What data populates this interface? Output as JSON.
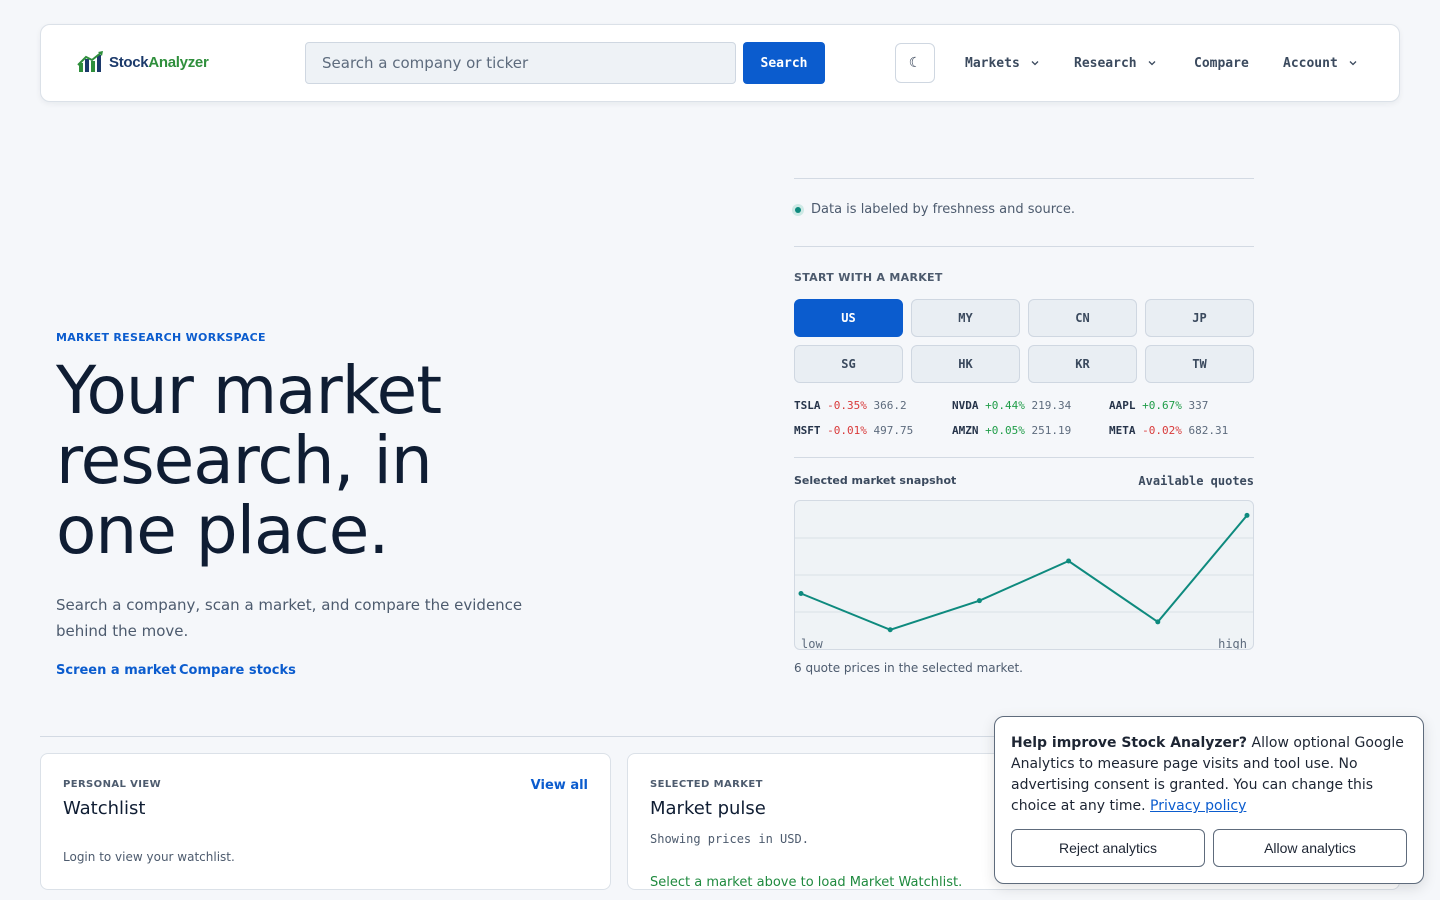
{
  "header": {
    "logo": {
      "part1": "Stock",
      "part2": "Analyzer"
    },
    "search": {
      "placeholder": "Search a company or ticker",
      "button_label": "Search"
    },
    "theme_toggle": "☾",
    "nav": [
      {
        "label": "Markets",
        "has_dropdown": true
      },
      {
        "label": "Research",
        "has_dropdown": true
      },
      {
        "label": "Compare",
        "has_dropdown": false
      },
      {
        "label": "Account",
        "has_dropdown": true
      }
    ]
  },
  "hero": {
    "eyebrow": "MARKET RESEARCH WORKSPACE",
    "headline": [
      "Your market",
      "research, in",
      "one place."
    ],
    "subtitle": "Search a company, scan a market, and compare the evidence behind the move.",
    "links": [
      "Screen a market",
      "Compare stocks"
    ]
  },
  "panel": {
    "freshness": "Data is labeled by freshness and source.",
    "market_label": "START WITH A MARKET",
    "markets": [
      "US",
      "MY",
      "CN",
      "JP",
      "SG",
      "HK",
      "KR",
      "TW"
    ],
    "active_market": "US",
    "quotes": [
      {
        "symbol": "TSLA",
        "change": "-0.35%",
        "price": "366.2",
        "direction": "down"
      },
      {
        "symbol": "NVDA",
        "change": "+0.44%",
        "price": "219.34",
        "direction": "up"
      },
      {
        "symbol": "AAPL",
        "change": "+0.67%",
        "price": "337",
        "direction": "up"
      },
      {
        "symbol": "MSFT",
        "change": "-0.01%",
        "price": "497.75",
        "direction": "down"
      },
      {
        "symbol": "AMZN",
        "change": "+0.05%",
        "price": "251.19",
        "direction": "up"
      },
      {
        "symbol": "META",
        "change": "-0.02%",
        "price": "682.31",
        "direction": "down"
      }
    ],
    "snapshot_title": "Selected market snapshot",
    "snapshot_right": "Available quotes",
    "chart_low": "low",
    "chart_high": "high",
    "chart_note": "6 quote prices in the selected market."
  },
  "chart_data": {
    "type": "line",
    "x": [
      1,
      2,
      3,
      4,
      5,
      6
    ],
    "values": [
      366.2,
      219.34,
      337,
      497.75,
      251.19,
      682.31
    ],
    "ylim": [
      190,
      700
    ],
    "grid": true,
    "color": "#0e8a7e"
  },
  "cards": {
    "watchlist": {
      "eyebrow": "PERSONAL VIEW",
      "title": "Watchlist",
      "link": "View all",
      "body": "Login to view your watchlist."
    },
    "pulse": {
      "eyebrow": "SELECTED MARKET",
      "title": "Market pulse",
      "currency": "Showing prices in USD.",
      "hint": "Select a market above to load Market Watchlist."
    }
  },
  "consent": {
    "heading": "Help improve Stock Analyzer?",
    "body": "Allow optional Google Analytics to measure page visits and tool use. No advertising consent is granted. You can change this choice at any time.",
    "link": "Privacy policy",
    "reject": "Reject analytics",
    "allow": "Allow analytics"
  },
  "colors": {
    "accent": "#0b5cce",
    "positive": "#1f9d48",
    "negative": "#d93a3a",
    "chart_line": "#0e8a7e"
  }
}
